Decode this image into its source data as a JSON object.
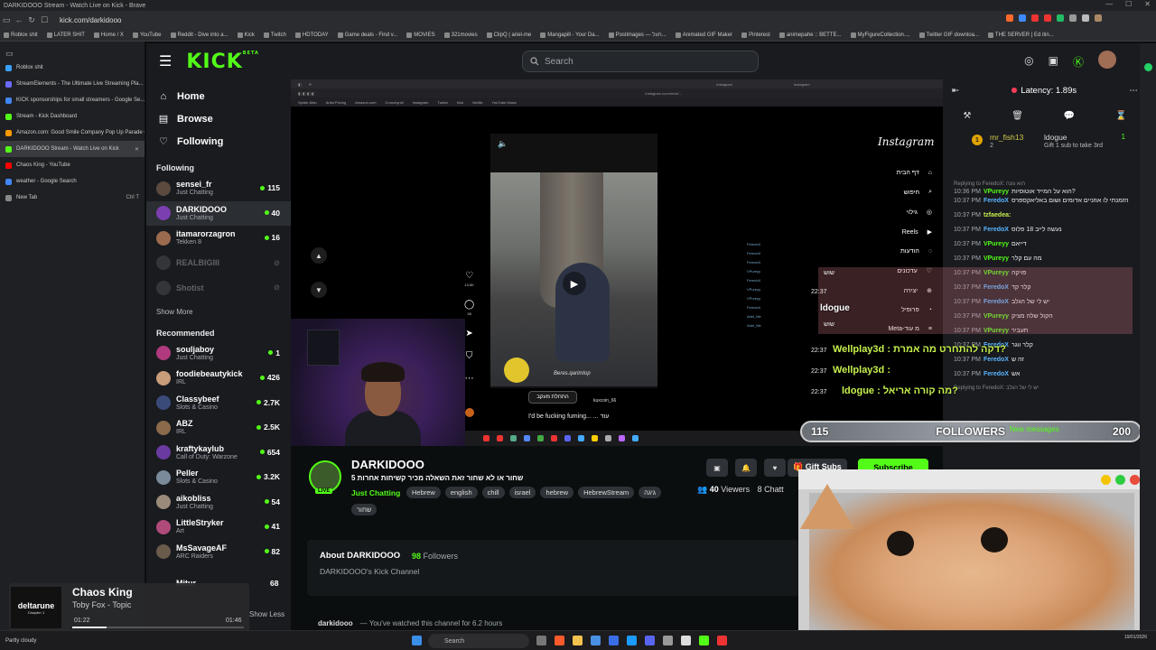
{
  "window": {
    "title": "DARKIDOOO Stream - Watch Live on Kick - Brave"
  },
  "browser": {
    "url": "kick.com/darkidooo"
  },
  "bookmarks": [
    "Roblox shit",
    "LATER SHIT",
    "Home / X",
    "YouTube",
    "Reddit - Dive into a...",
    "Kick",
    "Twitch",
    "HDTODAY",
    "Game deals - Find v...",
    "MOVIES",
    "321movies",
    "ClipQ | ariel-me",
    "Mangapill - Your Da...",
    "Postimages — העל...",
    "Animated GIF Maker",
    "Pinterest",
    "animepahe :: BETTE...",
    "MyFigureCollection....",
    "Twitter GIF downloa...",
    "THE SERVER | Ed itin..."
  ],
  "tabs": [
    {
      "label": "Roblox shit",
      "color": "#3aa0ff",
      "active": false
    },
    {
      "label": "StreamElements - The Ultimate Live Streaming Pla...",
      "color": "#6b6bff",
      "active": false
    },
    {
      "label": "KICK sponsorships for small streamers - Google Se...",
      "color": "#4285f4",
      "active": false
    },
    {
      "label": "Stream - Kick Dashboard",
      "color": "#53fc18",
      "active": false
    },
    {
      "label": "Amazon.com: Good Smile Company Pop Up Parade Chara...",
      "color": "#ff9900",
      "active": false
    },
    {
      "label": "DARKIDOOO Stream - Watch Live on Kick",
      "color": "#53fc18",
      "active": true
    },
    {
      "label": "Chaos King - YouTube",
      "color": "#ff0000",
      "active": false
    },
    {
      "label": "weather - Google Search",
      "color": "#4285f4",
      "active": false
    },
    {
      "label": "New Tab",
      "color": "#888888",
      "active": false
    }
  ],
  "new_tab_shortcut": "Ctrl T",
  "kick": {
    "logo": "KICK",
    "beta": "BETA",
    "search_placeholder": "Search",
    "nav": [
      {
        "label": "Home",
        "icon": "home-icon"
      },
      {
        "label": "Browse",
        "icon": "browse-icon"
      },
      {
        "label": "Following",
        "icon": "heart-icon"
      }
    ],
    "following_title": "Following",
    "following": [
      {
        "name": "sensei_fr",
        "category": "Just Chatting",
        "viewers": "115",
        "color": "#5b4a3d",
        "live": true
      },
      {
        "name": "DARKIDOOO",
        "category": "Just Chatting",
        "viewers": "40",
        "color": "#7b3fb0",
        "live": true
      },
      {
        "name": "itamarorzagron",
        "category": "Tekken 8",
        "viewers": "16",
        "color": "#9b6b4e",
        "live": true
      },
      {
        "name": "REALBIGIII",
        "category": "",
        "viewers": "",
        "color": "#666666",
        "live": false
      },
      {
        "name": "Shotist",
        "category": "",
        "viewers": "",
        "color": "#666666",
        "live": false
      }
    ],
    "show_more": "Show More",
    "recommended_title": "Recommended",
    "recommended": [
      {
        "name": "souljaboy",
        "category": "Just Chatting",
        "viewers": "1",
        "color": "#b03a7d"
      },
      {
        "name": "foodiebeautykick",
        "category": "IRL",
        "viewers": "426",
        "color": "#c99c7a"
      },
      {
        "name": "Classybeef",
        "category": "Slots & Casino",
        "viewers": "2.7K",
        "color": "#3a4b7a"
      },
      {
        "name": "ABZ",
        "category": "IRL",
        "viewers": "2.5K",
        "color": "#8a6a4a"
      },
      {
        "name": "kraftykaylub",
        "category": "Call of Duty: Warzone",
        "viewers": "654",
        "color": "#6a3aa0"
      },
      {
        "name": "Peller",
        "category": "Slots & Casino",
        "viewers": "3.2K",
        "color": "#7a8a9a"
      },
      {
        "name": "aikobliss",
        "category": "Just Chatting",
        "viewers": "54",
        "color": "#9a8a7a"
      },
      {
        "name": "LittleStryker",
        "category": "Art",
        "viewers": "41",
        "color": "#b04a7a"
      },
      {
        "name": "MsSavageAF",
        "category": "ARC Raiders",
        "viewers": "82",
        "color": "#6a5a4a"
      }
    ],
    "mitur": {
      "name": "Mitur",
      "viewers": "68"
    },
    "show_less": "Show Less"
  },
  "video": {
    "instagram_logo": "Instagram",
    "insta_nav": [
      "דף הבית",
      "חיפוש",
      "גילוי",
      "Reels",
      "הודעות",
      "עדכונים",
      "יצירה",
      "פרופיל",
      "Meta-מ עוד"
    ],
    "reel_button": "התחלת מעקב",
    "reel_user": "kuxcoin_66",
    "reel_caption": "I'd be fucking fuming... ... עוד",
    "reel_watermark": "Beres.qarimtop",
    "likes": "13.5K",
    "comments": "38",
    "url_text": "instagram.com/reels/..."
  },
  "channel": {
    "name": "DARKIDOOO",
    "live_badge": "LIVE",
    "stream_title": "5 שחור או לא שחור זאת השאלה מכיר קשיחות אחרות",
    "category": "Just Chatting",
    "tags": [
      "Hebrew",
      "english",
      "chill",
      "israel",
      "hebrew",
      "HebrewStream",
      "גיגה"
    ],
    "tag_extra": "שחור",
    "viewers": "40",
    "viewers_label": "Viewers",
    "chatters": "8 Chatt",
    "gift_subs": "Gift Subs",
    "subscribe": "Subscribe",
    "about_title": "About DARKIDOOO",
    "followers_count": "98",
    "followers_label": "Followers",
    "about_desc": "DARKIDOOO's Kick Channel",
    "watched_user": "darkidooo",
    "watched_text": "You've watched this channel for 6.2 hours"
  },
  "chat": {
    "latency": "Latency: 1.89s",
    "pinned": {
      "user1": "mr_fish13",
      "n1": "2",
      "user2": "ldogue",
      "text": "Gift 1 sub to take 3rd",
      "count": "1"
    },
    "messages": [
      {
        "reply": "Replying to FeredoX: הוא גונה",
        "time": "10:36 PM",
        "user": "VPureyy",
        "color": "#53fc18",
        "text": "הוא על המייד אוטוסיות?"
      },
      {
        "reply": "",
        "time": "10:37 PM",
        "user": "FeredoX",
        "color": "#5bb5ff",
        "text": "הזמנתי לו אוזניים אדומים ושום באליאקספרס"
      },
      {
        "reply": "",
        "time": "10:37 PM",
        "user": "tzfaedea:",
        "color": "#c6f04d",
        "text": ""
      },
      {
        "reply": "",
        "time": "10:37 PM",
        "user": "FeredoX",
        "color": "#5bb5ff",
        "text": "נעשה לייב 18 פלוס"
      },
      {
        "reply": "",
        "time": "10:37 PM",
        "user": "VPureyy",
        "color": "#53fc18",
        "text": "דייאם"
      },
      {
        "reply": "",
        "time": "10:37 PM",
        "user": "VPureyy",
        "color": "#53fc18",
        "text": "מה עם קלר"
      },
      {
        "reply": "",
        "time": "10:37 PM",
        "user": "VPureyy",
        "color": "#53fc18",
        "text": "פויקה"
      },
      {
        "reply": "",
        "time": "10:37 PM",
        "user": "FeredoX",
        "color": "#5bb5ff",
        "text": "קלר קד"
      },
      {
        "reply": "",
        "time": "10:37 PM",
        "user": "FeredoX",
        "color": "#5bb5ff",
        "text": "יש לי של הגלב"
      },
      {
        "reply": "",
        "time": "10:37 PM",
        "user": "VPureyy",
        "color": "#53fc18",
        "text": "הקול שלה מציק"
      },
      {
        "reply": "",
        "time": "10:37 PM",
        "user": "VPureyy",
        "color": "#53fc18",
        "text": "תעביר"
      },
      {
        "reply": "",
        "time": "10:37 PM",
        "user": "FeredoX",
        "color": "#5bb5ff",
        "text": "קלר ווגר"
      },
      {
        "reply": "",
        "time": "10:37 PM",
        "user": "FeredoX",
        "color": "#5bb5ff",
        "text": "זה ש"
      },
      {
        "reply": "",
        "time": "10:37 PM",
        "user": "FeredoX",
        "color": "#5bb5ff",
        "text": "אש"
      },
      {
        "reply": "Replying to FeredoX: יש לי של הגלב",
        "time": "",
        "user": "",
        "color": "#888888",
        "text": ""
      }
    ]
  },
  "overlay": {
    "line1_user": "שוש",
    "line1_ts": "22:37",
    "line2_user": "ldogue",
    "line2_text": "שוש",
    "line3_ts": "22:37",
    "line3_text": "Wellplay3d : דקה להתחרט מה אמרת?",
    "line4_ts": "22:37",
    "line4_text": "Wellplay3d :",
    "line5_ts": "22:37",
    "line5_text": "ldogue : מה קורה אריאל?",
    "followers_left": "115",
    "followers_label": "FOLLOWERS",
    "followers_right": "200",
    "new_messages": "New messages"
  },
  "music": {
    "art_title": "deltarune",
    "art_sub": "Chapter 1",
    "title": "Chaos King",
    "artist": "Toby Fox - Topic",
    "elapsed": "01:22",
    "total": "01:46",
    "progress": 0.2
  },
  "taskbar": {
    "search": "Search",
    "weather": "Partly cloudy",
    "date": "19/01/2026"
  }
}
